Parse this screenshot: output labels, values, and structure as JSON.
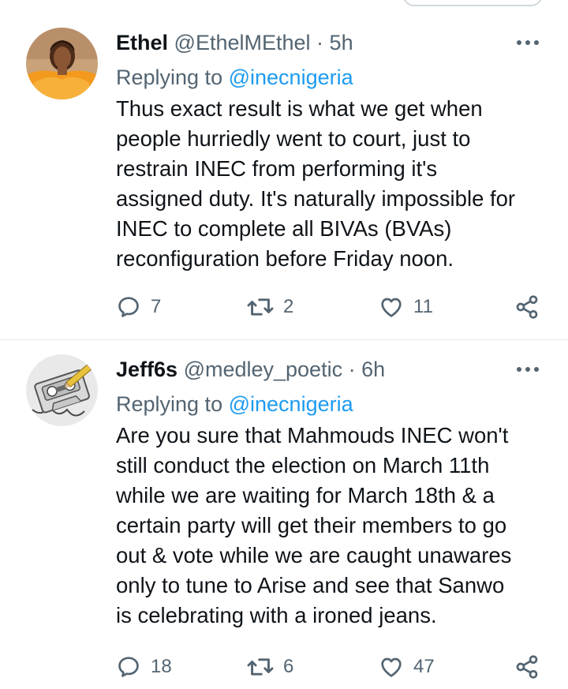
{
  "tweets": [
    {
      "display_name": "Ethel",
      "handle": "@EthelMEthel",
      "separator": "·",
      "time": "5h",
      "replying_prefix": "Replying to",
      "replying_to": "@inecnigeria",
      "text": "Thus exact result is what we get when\npeople hurriedly went to court, just to\nrestrain INEC from performing it's\nassigned duty. It's naturally impossible for\nINEC to complete all BIVAs (BVAs)\nreconfiguration before Friday noon.",
      "replies": "7",
      "retweets": "2",
      "likes": "11",
      "avatar_icon": "profile-photo-orange-dress"
    },
    {
      "display_name": "Jeff6s",
      "handle": "@medley_poetic",
      "separator": "·",
      "time": "6h",
      "replying_prefix": "Replying to",
      "replying_to": "@inecnigeria",
      "text": "Are you sure that Mahmouds INEC won't\nstill conduct the election on March 11th\nwhile we are waiting for March 18th & a\ncertain party will get their members to go\nout & vote while we are caught unawares\nonly to tune to Arise and see that Sanwo\nis celebrating with a ironed jeans.",
      "replies": "18",
      "retweets": "6",
      "likes": "47",
      "avatar_icon": "cassette-tape-with-pencil"
    }
  ],
  "colors": {
    "text_primary": "#0f1419",
    "text_secondary": "#536471",
    "link": "#1d9bf0",
    "divider": "#e6ecf0"
  },
  "icons": {
    "reply": "reply-icon",
    "retweet": "retweet-icon",
    "like": "like-icon",
    "share": "share-icon",
    "more": "more-icon"
  }
}
